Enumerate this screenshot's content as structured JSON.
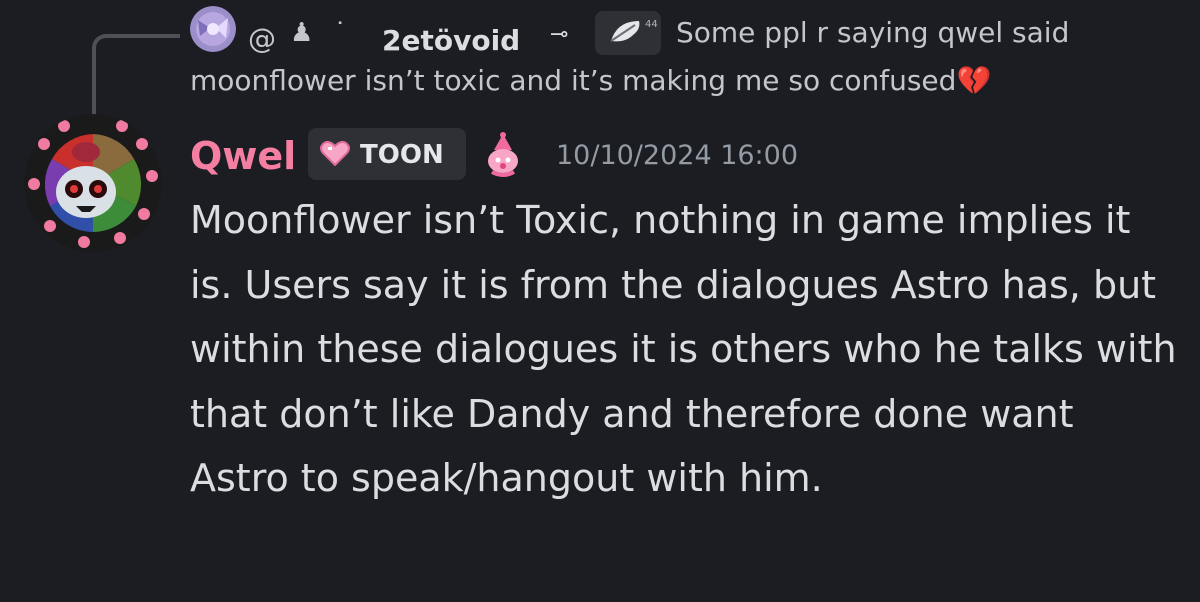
{
  "reply": {
    "at": "@",
    "glyphs": "♟ ˙",
    "username": "2etövoid",
    "decoration": "⊸",
    "text_line1": "Some ppl r saying qwel said",
    "text_line2": "moonflower isn’t toxic and it’s making me so confused",
    "emoji": "💔"
  },
  "message": {
    "author": "Qwel",
    "role": "TOON",
    "timestamp": "10/10/2024 16:00",
    "text": "Moonflower isn’t Toxic, nothing in game implies it is. Users say it is from the dialogues Astro has, but within these dialogues it is others who he talks with that don’t like Dandy and therefore done want Astro to speak/hangout with him."
  },
  "colors": {
    "background": "#1c1d23",
    "author": "#f47fa3",
    "timestamp": "#949ba4",
    "reply_spine": "#4e5058"
  }
}
